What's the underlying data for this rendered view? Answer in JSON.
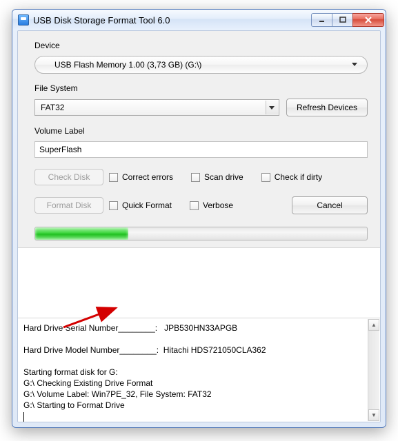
{
  "window": {
    "title": "USB Disk Storage Format Tool 6.0"
  },
  "labels": {
    "device": "Device",
    "filesystem": "File System",
    "volume": "Volume Label"
  },
  "device": {
    "selected": "USB Flash Memory  1.00 (3,73 GB) (G:\\)"
  },
  "filesystem": {
    "selected": "FAT32"
  },
  "volume": {
    "value": "SuperFlash"
  },
  "buttons": {
    "refresh": "Refresh Devices",
    "check_disk": "Check Disk",
    "format_disk": "Format Disk",
    "cancel": "Cancel"
  },
  "checks": {
    "correct_errors": "Correct errors",
    "scan_drive": "Scan drive",
    "check_if_dirty": "Check if dirty",
    "quick_format": "Quick Format",
    "verbose": "Verbose"
  },
  "progress": {
    "percent": 28
  },
  "log": {
    "lines": [
      "Hard Drive Serial Number________:   JPB530HN33APGB",
      "",
      "Hard Drive Model Number________:  Hitachi HDS721050CLA362",
      "",
      "Starting format disk for G:",
      "G:\\ Checking Existing Drive Format",
      "G:\\ Volume Label: Win7PE_32, File System: FAT32",
      "G:\\ Starting to Format Drive"
    ]
  }
}
